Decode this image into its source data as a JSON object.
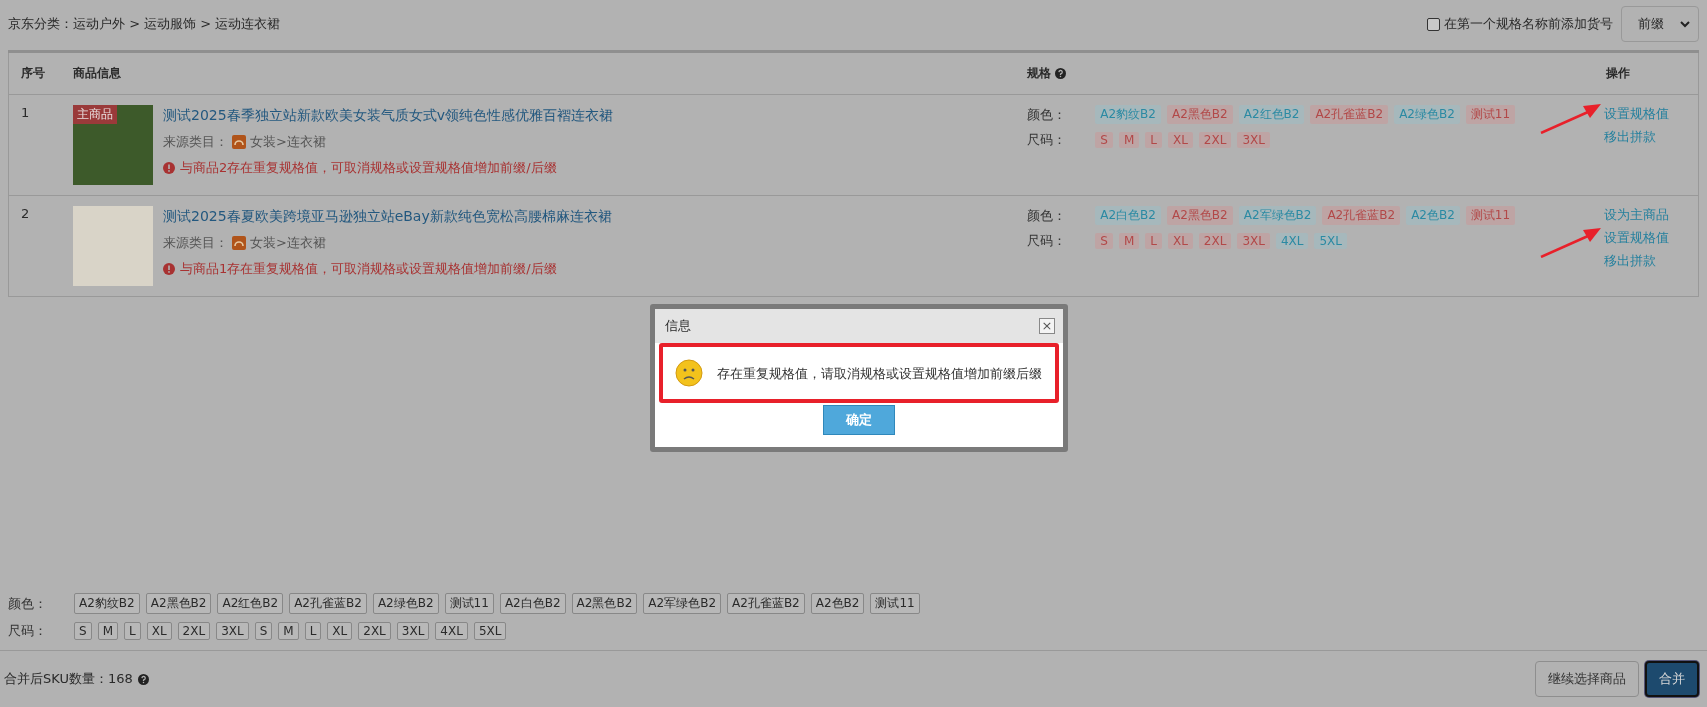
{
  "breadcrumb": "京东分类：运动户外 > 运动服饰 > 运动连衣裙",
  "sku_option": {
    "label": "在第一个规格名称前添加货号",
    "checked": false
  },
  "position_select": {
    "value": "前缀"
  },
  "table": {
    "columns": [
      "序号",
      "商品信息",
      "规格",
      "操作"
    ],
    "rows": [
      {
        "index": "1",
        "main": true,
        "main_badge": "主商品",
        "title": "测试2025春季独立站新款欧美女装气质女式v领纯色性感优雅百褶连衣裙",
        "source_label": "来源类目：",
        "source": "女装>连衣裙",
        "warning": "与商品2存在重复规格值，可取消规格或设置规格值增加前缀/后缀",
        "specs": [
          {
            "label": "颜色：",
            "values": [
              {
                "text": "A2豹纹B2",
                "duplicate": false
              },
              {
                "text": "A2黑色B2",
                "duplicate": true
              },
              {
                "text": "A2红色B2",
                "duplicate": false
              },
              {
                "text": "A2孔雀蓝B2",
                "duplicate": true
              },
              {
                "text": "A2绿色B2",
                "duplicate": false
              },
              {
                "text": "测试11",
                "duplicate": true
              }
            ]
          },
          {
            "label": "尺码：",
            "values": [
              {
                "text": "S",
                "duplicate": true
              },
              {
                "text": "M",
                "duplicate": true
              },
              {
                "text": "L",
                "duplicate": true
              },
              {
                "text": "XL",
                "duplicate": true
              },
              {
                "text": "2XL",
                "duplicate": true
              },
              {
                "text": "3XL",
                "duplicate": true
              }
            ]
          }
        ],
        "actions": [
          {
            "label": "设置规格值",
            "annotated": true
          },
          {
            "label": "移出拼款",
            "annotated": false
          }
        ]
      },
      {
        "index": "2",
        "main": false,
        "title": "测试2025春夏欧美跨境亚马逊独立站eBay新款纯色宽松高腰棉麻连衣裙",
        "source_label": "来源类目：",
        "source": "女装>连衣裙",
        "warning": "与商品1存在重复规格值，可取消规格或设置规格值增加前缀/后缀",
        "specs": [
          {
            "label": "颜色：",
            "values": [
              {
                "text": "A2白色B2",
                "duplicate": false
              },
              {
                "text": "A2黑色B2",
                "duplicate": true
              },
              {
                "text": "A2军绿色B2",
                "duplicate": false
              },
              {
                "text": "A2孔雀蓝B2",
                "duplicate": true
              },
              {
                "text": "A2色B2",
                "duplicate": false
              },
              {
                "text": "测试11",
                "duplicate": true
              }
            ]
          },
          {
            "label": "尺码：",
            "values": [
              {
                "text": "S",
                "duplicate": true
              },
              {
                "text": "M",
                "duplicate": true
              },
              {
                "text": "L",
                "duplicate": true
              },
              {
                "text": "XL",
                "duplicate": true
              },
              {
                "text": "2XL",
                "duplicate": true
              },
              {
                "text": "3XL",
                "duplicate": true
              },
              {
                "text": "4XL",
                "duplicate": false
              },
              {
                "text": "5XL",
                "duplicate": false
              }
            ]
          }
        ],
        "actions": [
          {
            "label": "设为主商品",
            "annotated": false
          },
          {
            "label": "设置规格值",
            "annotated": true
          },
          {
            "label": "移出拼款",
            "annotated": false
          }
        ]
      }
    ]
  },
  "summary": [
    {
      "label": "颜色：",
      "values": [
        "A2豹纹B2",
        "A2黑色B2",
        "A2红色B2",
        "A2孔雀蓝B2",
        "A2绿色B2",
        "测试11",
        "A2白色B2",
        "A2黑色B2",
        "A2军绿色B2",
        "A2孔雀蓝B2",
        "A2色B2",
        "测试11"
      ]
    },
    {
      "label": "尺码：",
      "values": [
        "S",
        "M",
        "L",
        "XL",
        "2XL",
        "3XL",
        "S",
        "M",
        "L",
        "XL",
        "2XL",
        "3XL",
        "4XL",
        "5XL"
      ]
    }
  ],
  "footer": {
    "sku_label": "合并后SKU数量：",
    "sku_count": "168",
    "buttons": [
      {
        "label": "继续选择商品",
        "primary": false
      },
      {
        "label": "合并",
        "primary": true
      }
    ]
  },
  "dialog": {
    "title": "信息",
    "close": "×",
    "message": "存在重复规格值，请取消规格或设置规格值增加前缀后缀",
    "highlighted": true,
    "ok": "确定"
  }
}
